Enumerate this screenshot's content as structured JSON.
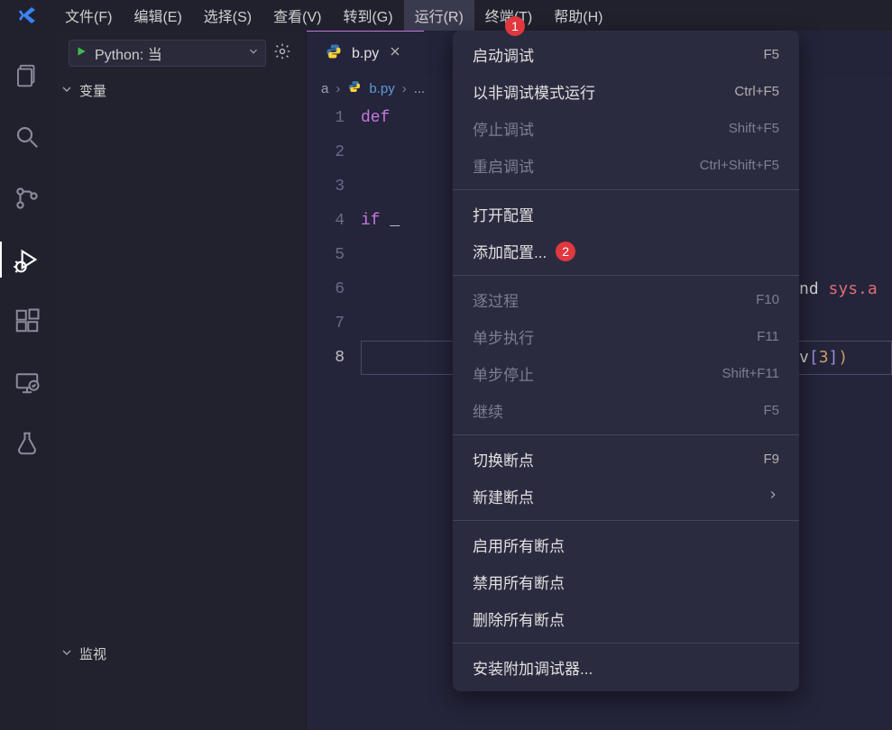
{
  "menubar": {
    "items": [
      "文件(F)",
      "编辑(E)",
      "选择(S)",
      "查看(V)",
      "转到(G)",
      "运行(R)",
      "终端(T)",
      "帮助(H)"
    ],
    "active_index": 5
  },
  "activitybar": {
    "active_index": 3
  },
  "sidebar": {
    "run_config_label": "Python: 当",
    "sections": {
      "variables": "变量",
      "watch": "监视"
    }
  },
  "tabs": {
    "active": {
      "label": "b.py"
    }
  },
  "breadcrumb": {
    "seg0": "a",
    "seg1": "b.py",
    "trailing": "..."
  },
  "code": {
    "lines": [
      {
        "n": "1",
        "kw": "def"
      },
      {
        "n": "2"
      },
      {
        "n": "3"
      },
      {
        "n": "4",
        "kw": "if",
        "rest": " _"
      },
      {
        "n": "5"
      },
      {
        "n": "6"
      },
      {
        "n": "7"
      },
      {
        "n": "8"
      }
    ],
    "right_fragment_1a": "nd ",
    "right_fragment_1b": "sys.a",
    "right_fragment_2a": "v",
    "right_fragment_2b": "[",
    "right_fragment_2c": "3",
    "right_fragment_2d": "]",
    "right_fragment_2e": ")"
  },
  "dropdown": {
    "items": [
      {
        "label": "启动调试",
        "shortcut": "F5",
        "disabled": false
      },
      {
        "label": "以非调试模式运行",
        "shortcut": "Ctrl+F5",
        "disabled": false
      },
      {
        "label": "停止调试",
        "shortcut": "Shift+F5",
        "disabled": true
      },
      {
        "label": "重启调试",
        "shortcut": "Ctrl+Shift+F5",
        "disabled": true
      },
      {
        "separator": true
      },
      {
        "label": "打开配置",
        "shortcut": "",
        "disabled": false
      },
      {
        "label": "添加配置...",
        "shortcut": "",
        "disabled": false,
        "badge": "2"
      },
      {
        "separator": true
      },
      {
        "label": "逐过程",
        "shortcut": "F10",
        "disabled": true
      },
      {
        "label": "单步执行",
        "shortcut": "F11",
        "disabled": true
      },
      {
        "label": "单步停止",
        "shortcut": "Shift+F11",
        "disabled": true
      },
      {
        "label": "继续",
        "shortcut": "F5",
        "disabled": true
      },
      {
        "separator": true
      },
      {
        "label": "切换断点",
        "shortcut": "F9",
        "disabled": false
      },
      {
        "label": "新建断点",
        "shortcut": "",
        "disabled": false,
        "submenu": true
      },
      {
        "separator": true
      },
      {
        "label": "启用所有断点",
        "shortcut": "",
        "disabled": false
      },
      {
        "label": "禁用所有断点",
        "shortcut": "",
        "disabled": false
      },
      {
        "label": "删除所有断点",
        "shortcut": "",
        "disabled": false
      },
      {
        "separator": true
      },
      {
        "label": "安装附加调试器...",
        "shortcut": "",
        "disabled": false
      }
    ]
  },
  "badges": {
    "one": "1"
  }
}
